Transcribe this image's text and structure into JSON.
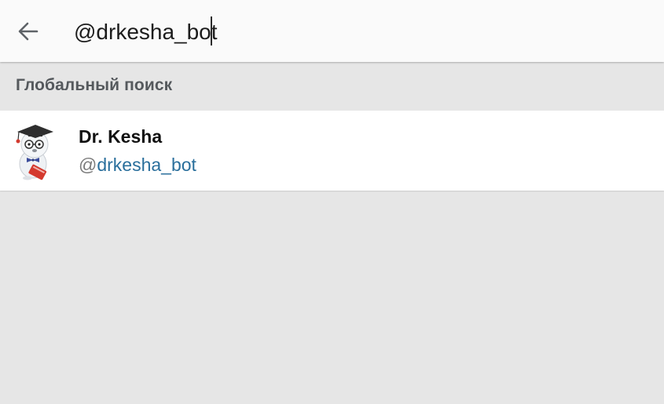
{
  "search": {
    "value": "@drkesha_bot"
  },
  "section": {
    "title": "Глобальный поиск"
  },
  "results": [
    {
      "name": "Dr. Kesha",
      "at": "@",
      "handle": "drkesha_bot",
      "avatar_icon": "bot-mascot-graduation-cap-avatar"
    }
  ],
  "colors": {
    "topbar": "#fafafa",
    "background": "#e6e6e6",
    "handle_link": "#2a6f9c",
    "section_text": "#55595d"
  }
}
